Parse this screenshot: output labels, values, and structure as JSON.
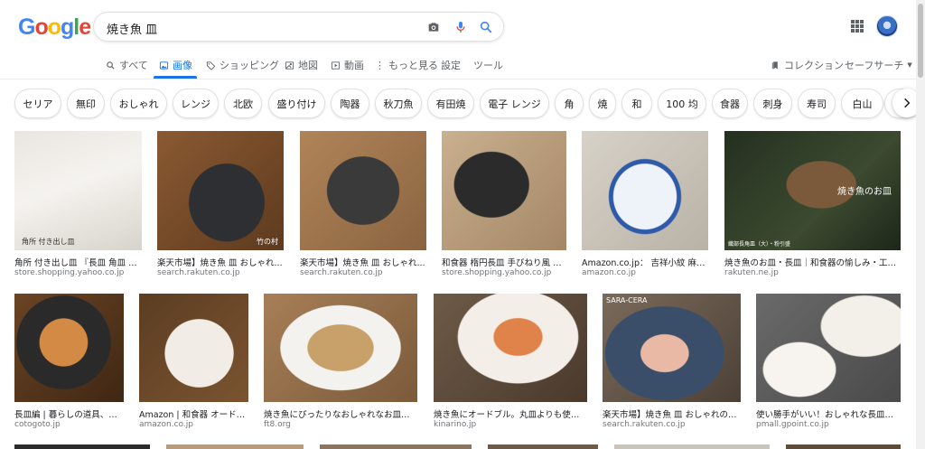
{
  "header": {
    "logo": [
      "G",
      "o",
      "o",
      "g",
      "l",
      "e"
    ],
    "logo_colors": [
      "#4285F4",
      "#EA4335",
      "#FBBC05",
      "#4285F4",
      "#34A853",
      "#EA4335"
    ],
    "query": "焼き魚 皿"
  },
  "tabs": {
    "all": "すべて",
    "images": "画像",
    "shopping": "ショッピング",
    "maps": "地図",
    "videos": "動画",
    "more": "もっと見る",
    "settings": "設定",
    "tools": "ツール",
    "collections": "コレクション",
    "safesearch": "セーフサーチ"
  },
  "chips": [
    "セリア",
    "無印",
    "おしゃれ",
    "レンジ",
    "北欧",
    "盛り付け",
    "陶器",
    "秋刀魚",
    "有田焼",
    "電子 レンジ",
    "角",
    "焼",
    "和",
    "100 均",
    "食器",
    "刺身",
    "寿司",
    "白山"
  ],
  "results": [
    {
      "caption": "角所 付き出し皿 『長皿 角皿 焼...",
      "source": "store.shopping.yahoo.co.jp",
      "label": "角所 付き出し皿"
    },
    {
      "caption": "楽天市場】焼き魚 皿 おしゃれ...",
      "source": "search.rakuten.co.jp",
      "watermark": "竹の村"
    },
    {
      "caption": "楽天市場】焼き魚 皿 おしゃれ...",
      "source": "search.rakuten.co.jp"
    },
    {
      "caption": "和食器 楕円長皿 手びねり風 29...",
      "source": "store.shopping.yahoo.co.jp"
    },
    {
      "caption": "Amazon.co.jp： 吉祥小紋 麻の...",
      "source": "amazon.co.jp"
    },
    {
      "caption": "焼き魚のお皿・長皿｜和食器の愉しみ・工芸...",
      "source": "rakuten.ne.jp",
      "watermark": "焼き魚のお皿",
      "watermark2": "織部長角皿（大）・粉引盛"
    },
    {
      "caption": "長皿編 | 暮らしの道具、衛...",
      "source": "cotogoto.jp"
    },
    {
      "caption": "Amazon | 和食器 オードブ...",
      "source": "amazon.co.jp"
    },
    {
      "caption": "焼き魚にぴったりなおしゃれなお皿お...",
      "source": "ft8.org"
    },
    {
      "caption": "焼き魚にオードブル。丸皿よりも使い...",
      "source": "kinarino.jp"
    },
    {
      "caption": "楽天市場】焼き魚 皿 おしゃれの通販",
      "source": "search.rakuten.co.jp",
      "watermark": "SARA-CERA"
    },
    {
      "caption": "使い勝手がいい！おしゃれな長皿の...",
      "source": "pmall.gpoint.co.jp"
    }
  ]
}
